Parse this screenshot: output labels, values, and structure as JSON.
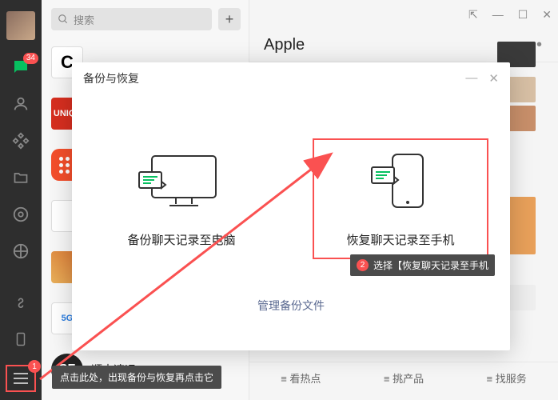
{
  "sidebar": {
    "badge": "34",
    "hb_num": "1"
  },
  "search": {
    "placeholder": "搜索"
  },
  "conv": {
    "uniqlo_a": "UNI",
    "uniqlo_b": "QL",
    "apple_glyph": "",
    "sf_glyph": "SF",
    "sf_name": "顺丰速运",
    "five_g": "5G",
    "c_glyph": "C"
  },
  "header": {
    "title": "Apple"
  },
  "modal": {
    "title": "备份与恢复",
    "backup_label": "备份聊天记录至电脑",
    "restore_label": "恢复聊天记录至手机",
    "manage": "管理备份文件"
  },
  "tips": {
    "t1": "点击此处，出现备份与恢复再点击它",
    "t2_num": "2",
    "t2": "选择【恢复聊天记录至手机"
  },
  "tabs": {
    "a": "≡ 看热点",
    "b": "≡ 挑产品",
    "c": "≡ 找服务"
  }
}
